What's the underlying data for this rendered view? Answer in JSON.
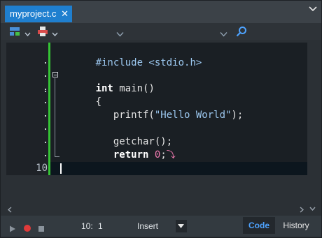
{
  "tab": {
    "title": "myproject.c",
    "close_glyph": "✕"
  },
  "editor": {
    "lines": [
      {
        "number": "",
        "code": "#include <stdio.h>"
      },
      {
        "number": "",
        "code": ""
      },
      {
        "number": "",
        "code": "int main()"
      },
      {
        "number": "",
        "code": "{"
      },
      {
        "number": "",
        "code": "   printf(\"Hello World\");"
      },
      {
        "number": "",
        "code": ""
      },
      {
        "number": "",
        "code": "   getchar();"
      },
      {
        "number": "",
        "code": "   return 0;"
      },
      {
        "number": "",
        "code": "}"
      },
      {
        "number": "10",
        "code": ""
      }
    ]
  },
  "status": {
    "line": "10:",
    "col": "1",
    "mode": "Insert"
  },
  "view_tabs": {
    "code": "Code",
    "history": "History"
  },
  "colors": {
    "tab_active": "#1f7fcf",
    "changed_bar": "#35c435",
    "accent_text": "#4ea3ff"
  }
}
